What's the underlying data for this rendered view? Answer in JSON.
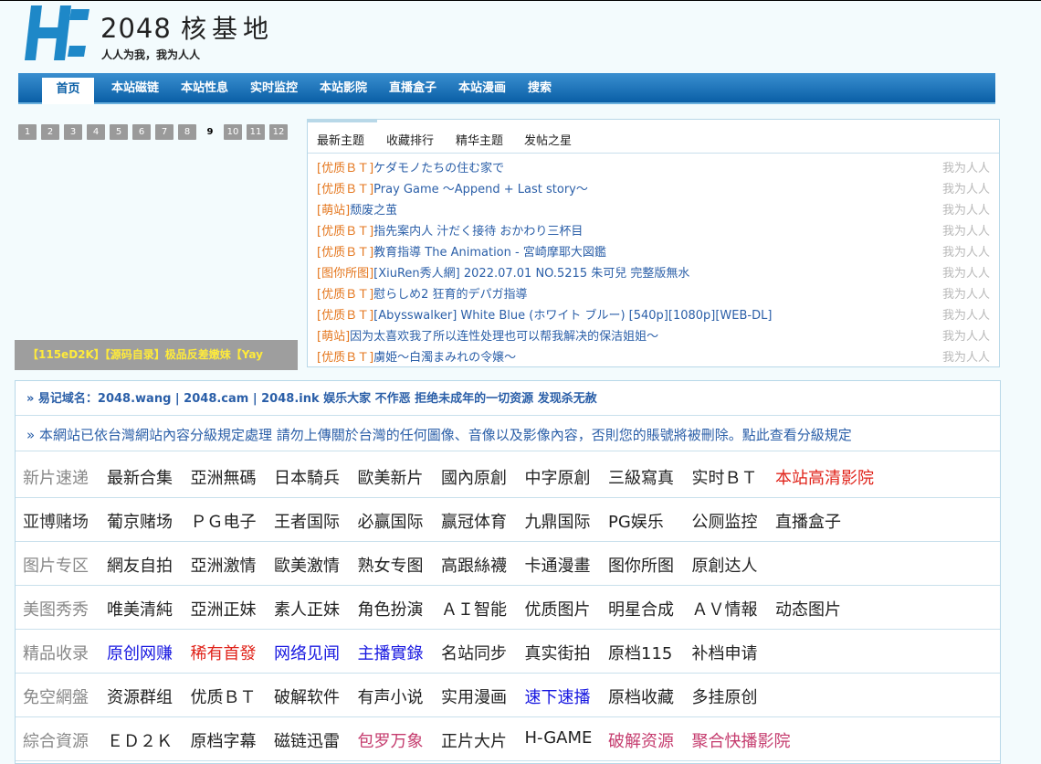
{
  "header": {
    "site_number": "2048",
    "site_name_cn": "核基地",
    "slogan": "人人为我，我为人人"
  },
  "nav": {
    "items": [
      {
        "label": "首页",
        "active": true
      },
      {
        "label": "本站磁链"
      },
      {
        "label": "本站性息"
      },
      {
        "label": "实时监控"
      },
      {
        "label": "本站影院"
      },
      {
        "label": "直播盒子"
      },
      {
        "label": "本站漫画"
      },
      {
        "label": "搜索"
      }
    ]
  },
  "pagination": [
    "1",
    "2",
    "3",
    "4",
    "5",
    "6",
    "7",
    "8",
    "9",
    "10",
    "11",
    "12"
  ],
  "current_page": "9",
  "banner_caption": "【115eD2K】【源码自录】极品反差嫩妹【Yay",
  "topics": {
    "tabs": [
      "最新主题",
      "收藏排行",
      "精华主题",
      "发帖之星"
    ],
    "rows": [
      {
        "cat": "[优质ＢＴ]",
        "title": "ケダモノたちの住む家で",
        "author": "我为人人"
      },
      {
        "cat": "[优质ＢＴ]",
        "title": "Pray Game ～Append + Last story～",
        "author": "我为人人"
      },
      {
        "cat": "[萌站]",
        "title": "颓废之茧",
        "author": "我为人人"
      },
      {
        "cat": "[优质ＢＴ]",
        "title": "指先案内人 汁だく接待 おかわり三杯目",
        "author": "我为人人"
      },
      {
        "cat": "[优质ＢＴ]",
        "title": "教育指導 The Animation - 宮崎摩耶大図鑑",
        "author": "我为人人"
      },
      {
        "cat": "[图你所图]",
        "title": "[XiuRen秀人網] 2022.07.01 NO.5215 朱可兒 完整版無水",
        "author": "我为人人"
      },
      {
        "cat": "[优质ＢＴ]",
        "title": "慰らしめ2 狂育的デパガ指導",
        "author": "我为人人"
      },
      {
        "cat": "[优质ＢＴ]",
        "title": "[Abysswalker] White Blue (ホワイト ブルー) [540p][1080p][WEB-DL]",
        "author": "我为人人"
      },
      {
        "cat": "[萌站]",
        "title": "因为太喜欢我了所以连性处理也可以帮我解决的保洁姐姐～",
        "author": "我为人人"
      },
      {
        "cat": "[优质ＢＴ]",
        "title": "虜姫～白濁まみれの令嬢～",
        "author": "我为人人"
      }
    ]
  },
  "notices": {
    "domains": "»  易记域名：2048.wang | 2048.cam | 2048.ink 娱乐大家 不作恶 拒绝未成年的一切资源 发现杀无赦",
    "rating": "»  本網站已依台灣網站內容分級規定處理 請勿上傳關於台灣的任何圖像、音像以及影像內容，否則您的賬號將被刪除。點此查看分級規定"
  },
  "colors": {
    "black": "#222222",
    "red": "#e0231a",
    "blue": "#1616e0",
    "pink": "#c53c6e",
    "nav_blue": "#0a5fa6",
    "orange": "#e4761d"
  },
  "directory": [
    {
      "head": "新片速递",
      "head_dark": false,
      "items": [
        {
          "t": "最新合集",
          "c": "black"
        },
        {
          "t": "亞洲無碼",
          "c": "black"
        },
        {
          "t": "日本騎兵",
          "c": "black"
        },
        {
          "t": "歐美新片",
          "c": "black"
        },
        {
          "t": "國內原創",
          "c": "black"
        },
        {
          "t": "中字原創",
          "c": "black"
        },
        {
          "t": "三級寫真",
          "c": "black"
        },
        {
          "t": "实时ＢＴ",
          "c": "black"
        },
        {
          "t": "本站高清影院",
          "c": "red"
        }
      ]
    },
    {
      "head": "亚博赌场",
      "head_dark": true,
      "items": [
        {
          "t": "葡京赌场",
          "c": "black"
        },
        {
          "t": "ＰＧ电子",
          "c": "black"
        },
        {
          "t": "王者国际",
          "c": "black"
        },
        {
          "t": "必赢国际",
          "c": "black"
        },
        {
          "t": "赢冠体育",
          "c": "black"
        },
        {
          "t": "九鼎国际",
          "c": "black"
        },
        {
          "t": "PG娱乐",
          "c": "black"
        },
        {
          "t": "公厕监控",
          "c": "black"
        },
        {
          "t": "直播盒子",
          "c": "black"
        }
      ]
    },
    {
      "head": "图片专区",
      "head_dark": false,
      "items": [
        {
          "t": "網友自拍",
          "c": "black"
        },
        {
          "t": "亞洲激情",
          "c": "black"
        },
        {
          "t": "歐美激情",
          "c": "black"
        },
        {
          "t": "熟女专图",
          "c": "black"
        },
        {
          "t": "高跟絲襪",
          "c": "black"
        },
        {
          "t": "卡通漫畫",
          "c": "black"
        },
        {
          "t": "图你所图",
          "c": "black"
        },
        {
          "t": "原創达人",
          "c": "black"
        }
      ]
    },
    {
      "head": "美图秀秀",
      "head_dark": false,
      "items": [
        {
          "t": "唯美清純",
          "c": "black"
        },
        {
          "t": "亞洲正妹",
          "c": "black"
        },
        {
          "t": "素人正妹",
          "c": "black"
        },
        {
          "t": "角色扮演",
          "c": "black"
        },
        {
          "t": "ＡＩ智能",
          "c": "black"
        },
        {
          "t": "优质图片",
          "c": "black"
        },
        {
          "t": "明星合成",
          "c": "black"
        },
        {
          "t": "ＡＶ情報",
          "c": "black"
        },
        {
          "t": "动态图片",
          "c": "black"
        }
      ]
    },
    {
      "head": "精品收录",
      "head_dark": false,
      "items": [
        {
          "t": "原创网赚",
          "c": "blue"
        },
        {
          "t": "稀有首發",
          "c": "red"
        },
        {
          "t": "网络见闻",
          "c": "blue"
        },
        {
          "t": "主播實錄",
          "c": "blue"
        },
        {
          "t": "名站同步",
          "c": "black"
        },
        {
          "t": "真实街拍",
          "c": "black"
        },
        {
          "t": "原档115",
          "c": "black"
        },
        {
          "t": "补档申请",
          "c": "black"
        }
      ]
    },
    {
      "head": "免空網盤",
      "head_dark": false,
      "items": [
        {
          "t": "资源群组",
          "c": "black"
        },
        {
          "t": "优质ＢＴ",
          "c": "black"
        },
        {
          "t": "破解软件",
          "c": "black"
        },
        {
          "t": "有声小说",
          "c": "black"
        },
        {
          "t": "实用漫画",
          "c": "black"
        },
        {
          "t": "速下速播",
          "c": "blue"
        },
        {
          "t": "原档收藏",
          "c": "black"
        },
        {
          "t": "多挂原创",
          "c": "black"
        }
      ]
    },
    {
      "head": "綜合資源",
      "head_dark": false,
      "items": [
        {
          "t": "ＥＤ２Ｋ",
          "c": "black"
        },
        {
          "t": "原档字幕",
          "c": "black"
        },
        {
          "t": "磁链迅雷",
          "c": "black"
        },
        {
          "t": "包罗万象",
          "c": "pink"
        },
        {
          "t": "正片大片",
          "c": "black"
        },
        {
          "t": "H-GAME",
          "c": "black"
        },
        {
          "t": "破解资源",
          "c": "pink"
        },
        {
          "t": "聚合快播影院",
          "c": "pink"
        }
      ]
    }
  ]
}
